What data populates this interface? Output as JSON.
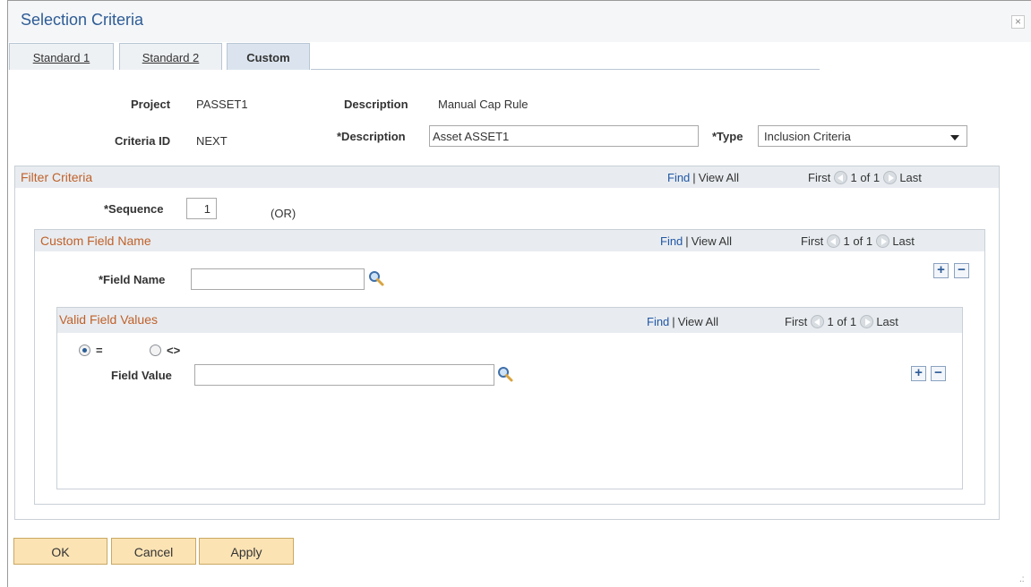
{
  "dialog": {
    "title": "Selection Criteria",
    "close_label": "×"
  },
  "tabs": [
    {
      "label": "Standard 1",
      "active": false
    },
    {
      "label": "Standard 2",
      "active": false
    },
    {
      "label": "Custom",
      "active": true
    }
  ],
  "header": {
    "project_label": "Project",
    "project_value": "PASSET1",
    "description_label": "Description",
    "description_value": "Manual Cap Rule",
    "criteria_id_label": "Criteria ID",
    "criteria_id_value": "NEXT",
    "description_field_label": "*Description",
    "description_field_value": "Asset ASSET1",
    "type_label": "*Type",
    "type_value": "Inclusion Criteria"
  },
  "filter_criteria": {
    "title": "Filter Criteria",
    "find": "Find",
    "view_all": "View All",
    "first": "First",
    "count": "1 of 1",
    "last": "Last",
    "sequence_label": "*Sequence",
    "sequence_value": "1",
    "or_label": "(OR)"
  },
  "custom_field_name": {
    "title": "Custom Field Name",
    "find": "Find",
    "view_all": "View All",
    "first": "First",
    "count": "1 of 1",
    "last": "Last",
    "field_name_label": "*Field Name",
    "field_name_value": ""
  },
  "valid_field_values": {
    "title": "Valid Field Values",
    "find": "Find",
    "view_all": "View All",
    "first": "First",
    "count": "1 of 1",
    "last": "Last",
    "radio_equal_label": "=",
    "radio_not_equal_label": "<>",
    "selected_operator": "=",
    "field_value_label": "Field Value",
    "field_value_value": ""
  },
  "buttons": {
    "ok": "OK",
    "cancel": "Cancel",
    "apply": "Apply"
  },
  "colors": {
    "title": "#2e5c95",
    "group_title": "#c0612a",
    "link": "#2257a5",
    "button_bg": "#fbe3b4"
  },
  "icons": {
    "lookup": "magnifier-icon",
    "add": "plus-icon",
    "delete": "minus-icon",
    "prev": "prev-arrow-icon",
    "next": "next-arrow-icon"
  }
}
